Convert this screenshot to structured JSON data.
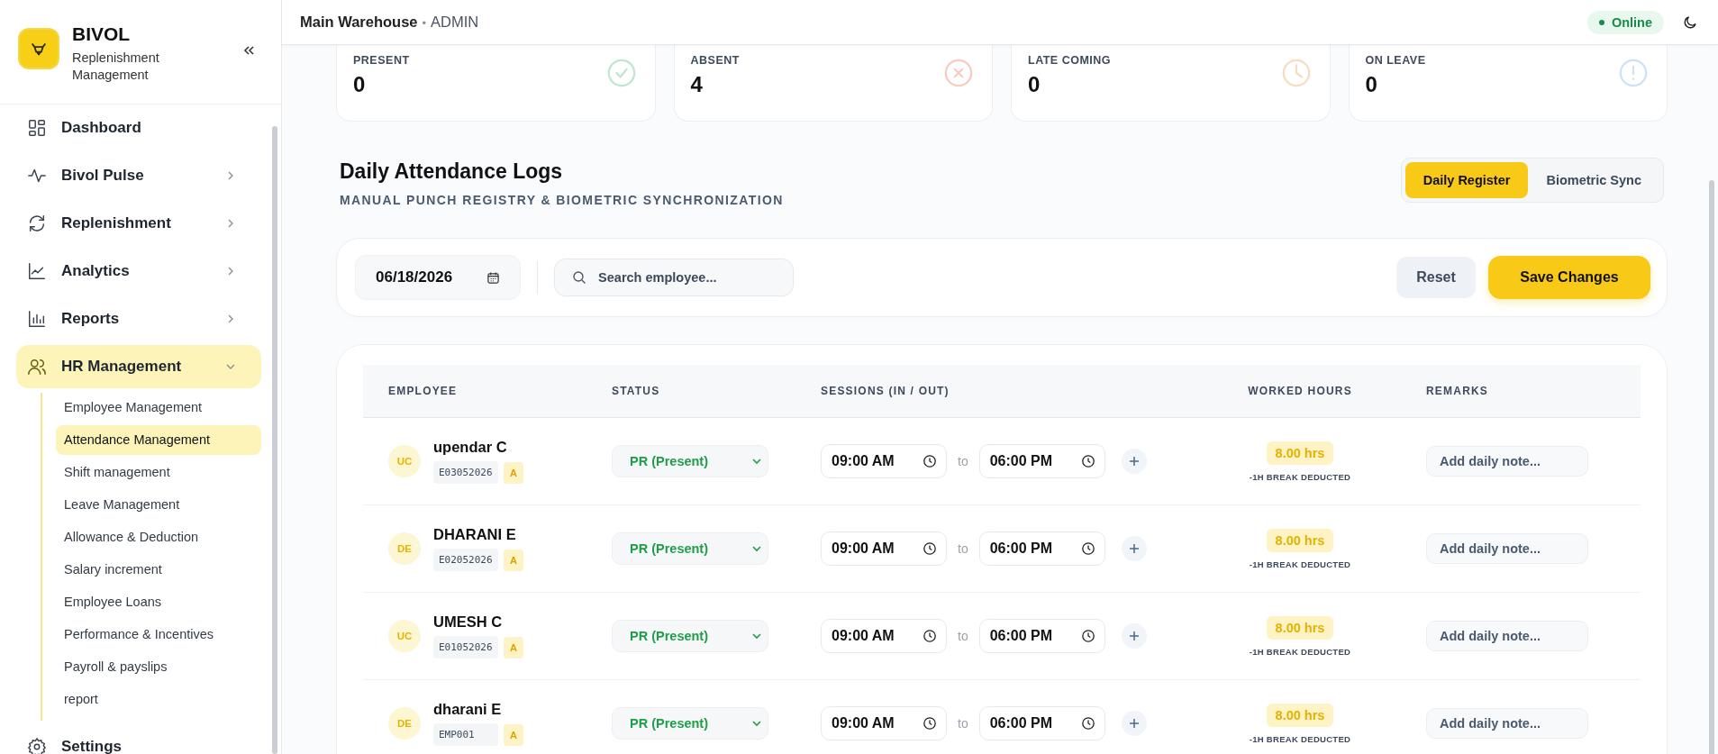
{
  "brand": {
    "name": "BIVOL",
    "subtitle": "Replenishment Management"
  },
  "nav": [
    {
      "label": "Dashboard",
      "kind": "link",
      "selected": false
    },
    {
      "label": "Bivol Pulse",
      "kind": "group",
      "expanded": false,
      "selected": false
    },
    {
      "label": "Replenishment",
      "kind": "group",
      "expanded": false,
      "selected": false
    },
    {
      "label": "Analytics",
      "kind": "group",
      "expanded": false,
      "selected": false
    },
    {
      "label": "Reports",
      "kind": "group",
      "expanded": false,
      "selected": false
    },
    {
      "label": "HR Management",
      "kind": "group",
      "expanded": true,
      "selected": true,
      "children": [
        {
          "label": "Employee Management",
          "selected": false
        },
        {
          "label": "Attendance Management",
          "selected": true
        },
        {
          "label": "Shift management",
          "selected": false
        },
        {
          "label": "Leave Management",
          "selected": false
        },
        {
          "label": "Allowance & Deduction",
          "selected": false
        },
        {
          "label": "Salary increment",
          "selected": false
        },
        {
          "label": "Employee Loans",
          "selected": false
        },
        {
          "label": "Performance & Incentives",
          "selected": false
        },
        {
          "label": "Payroll & payslips",
          "selected": false
        },
        {
          "label": "report",
          "selected": false
        }
      ]
    },
    {
      "label": "Settings",
      "kind": "link",
      "selected": false
    }
  ],
  "header": {
    "location": "Main Warehouse",
    "separator": "•",
    "role": "ADMIN",
    "status": {
      "label": "Online",
      "online": true
    }
  },
  "stats": [
    {
      "label": "PRESENT",
      "value": "0",
      "kind": "check",
      "color": "#bfe6d1"
    },
    {
      "label": "ABSENT",
      "value": "4",
      "kind": "cross",
      "color": "#f8cbbf"
    },
    {
      "label": "LATE COMING",
      "value": "0",
      "kind": "clock",
      "color": "#f8dcc0"
    },
    {
      "label": "ON LEAVE",
      "value": "0",
      "kind": "alert",
      "color": "#cfe1f6"
    }
  ],
  "section": {
    "title": "Daily Attendance Logs",
    "subtitle": "MANUAL PUNCH REGISTRY & BIOMETRIC SYNCHRONIZATION"
  },
  "tabs": [
    {
      "label": "Daily Register",
      "selected": true
    },
    {
      "label": "Biometric Sync",
      "selected": false
    }
  ],
  "toolbar": {
    "date": "06/18/2026",
    "search_placeholder": "Search employee...",
    "reset": "Reset",
    "save": "Save Changes"
  },
  "table": {
    "columns": [
      "EMPLOYEE",
      "STATUS",
      "SESSIONS (IN / OUT)",
      "WORKED HOURS",
      "REMARKS"
    ],
    "rows": [
      {
        "initials": "UC",
        "name": "upendar C",
        "code": "E03052026",
        "badge": "A",
        "status": "PR (Present)",
        "in": "09:00 AM",
        "to": "to",
        "out": "06:00 PM",
        "hours": "8.00 hrs",
        "note": "-1H BREAK DEDUCTED",
        "remarks_placeholder": "Add daily note..."
      },
      {
        "initials": "DE",
        "name": "DHARANI E",
        "code": "E02052026",
        "badge": "A",
        "status": "PR (Present)",
        "in": "09:00 AM",
        "to": "to",
        "out": "06:00 PM",
        "hours": "8.00 hrs",
        "note": "-1H BREAK DEDUCTED",
        "remarks_placeholder": "Add daily note..."
      },
      {
        "initials": "UC",
        "name": "UMESH C",
        "code": "E01052026",
        "badge": "A",
        "status": "PR (Present)",
        "in": "09:00 AM",
        "to": "to",
        "out": "06:00 PM",
        "hours": "8.00 hrs",
        "note": "-1H BREAK DEDUCTED",
        "remarks_placeholder": "Add daily note..."
      },
      {
        "initials": "DE",
        "name": "dharani E",
        "code": "EMP001",
        "badge": "A",
        "status": "PR (Present)",
        "in": "09:00 AM",
        "to": "to",
        "out": "06:00 PM",
        "hours": "8.00 hrs",
        "note": "-1H BREAK DEDUCTED",
        "remarks_placeholder": "Add daily note..."
      }
    ]
  }
}
